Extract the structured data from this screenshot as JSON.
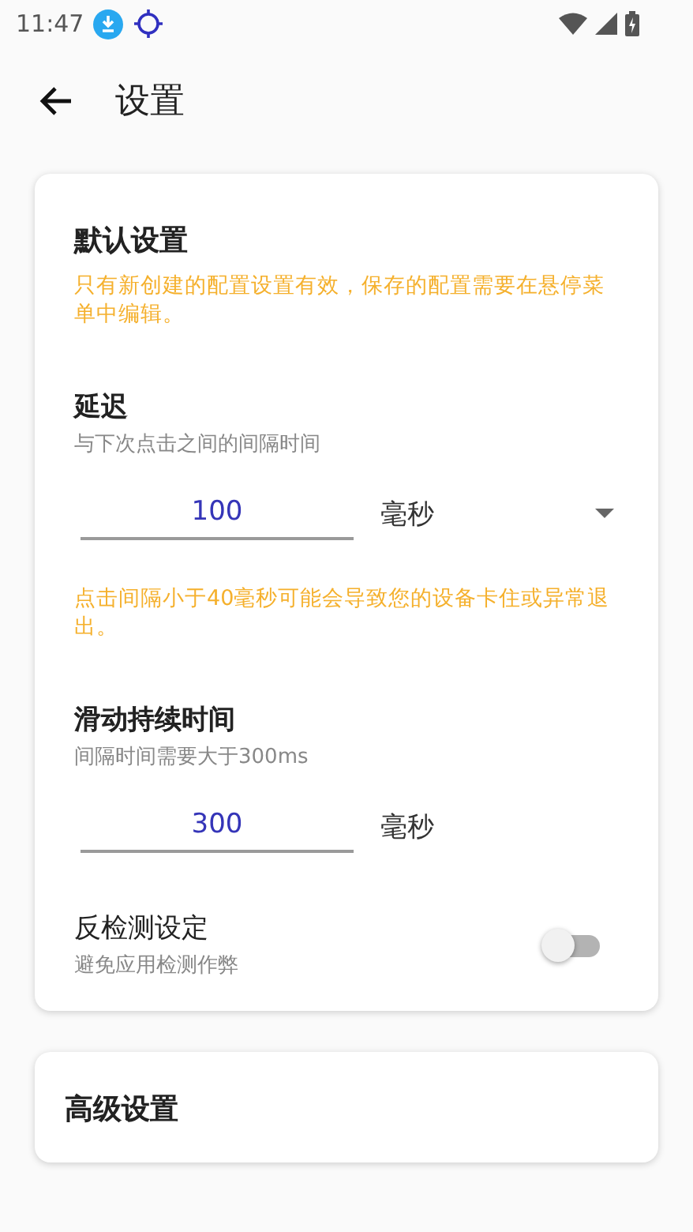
{
  "status_bar": {
    "time": "11:47"
  },
  "app_bar": {
    "title": "设置"
  },
  "cards": [
    {
      "title": "默认设置",
      "note": "只有新创建的配置设置有效，保存的配置需要在悬停菜单中编辑。",
      "settings": [
        {
          "kind": "number",
          "title": "延迟",
          "subtitle": "与下次点击之间的间隔时间",
          "value": "100",
          "unit": "毫秒",
          "dropdown": true,
          "warning": "点击间隔小于40毫秒可能会导致您的设备卡住或异常退出。"
        },
        {
          "kind": "number",
          "title": "滑动持续时间",
          "subtitle": "间隔时间需要大于300ms",
          "value": "300",
          "unit": "毫秒",
          "dropdown": false
        },
        {
          "kind": "switch",
          "title": "反检测设定",
          "subtitle": "避免应用检测作弊",
          "on": false
        }
      ]
    },
    {
      "title": "高级设置"
    }
  ]
}
